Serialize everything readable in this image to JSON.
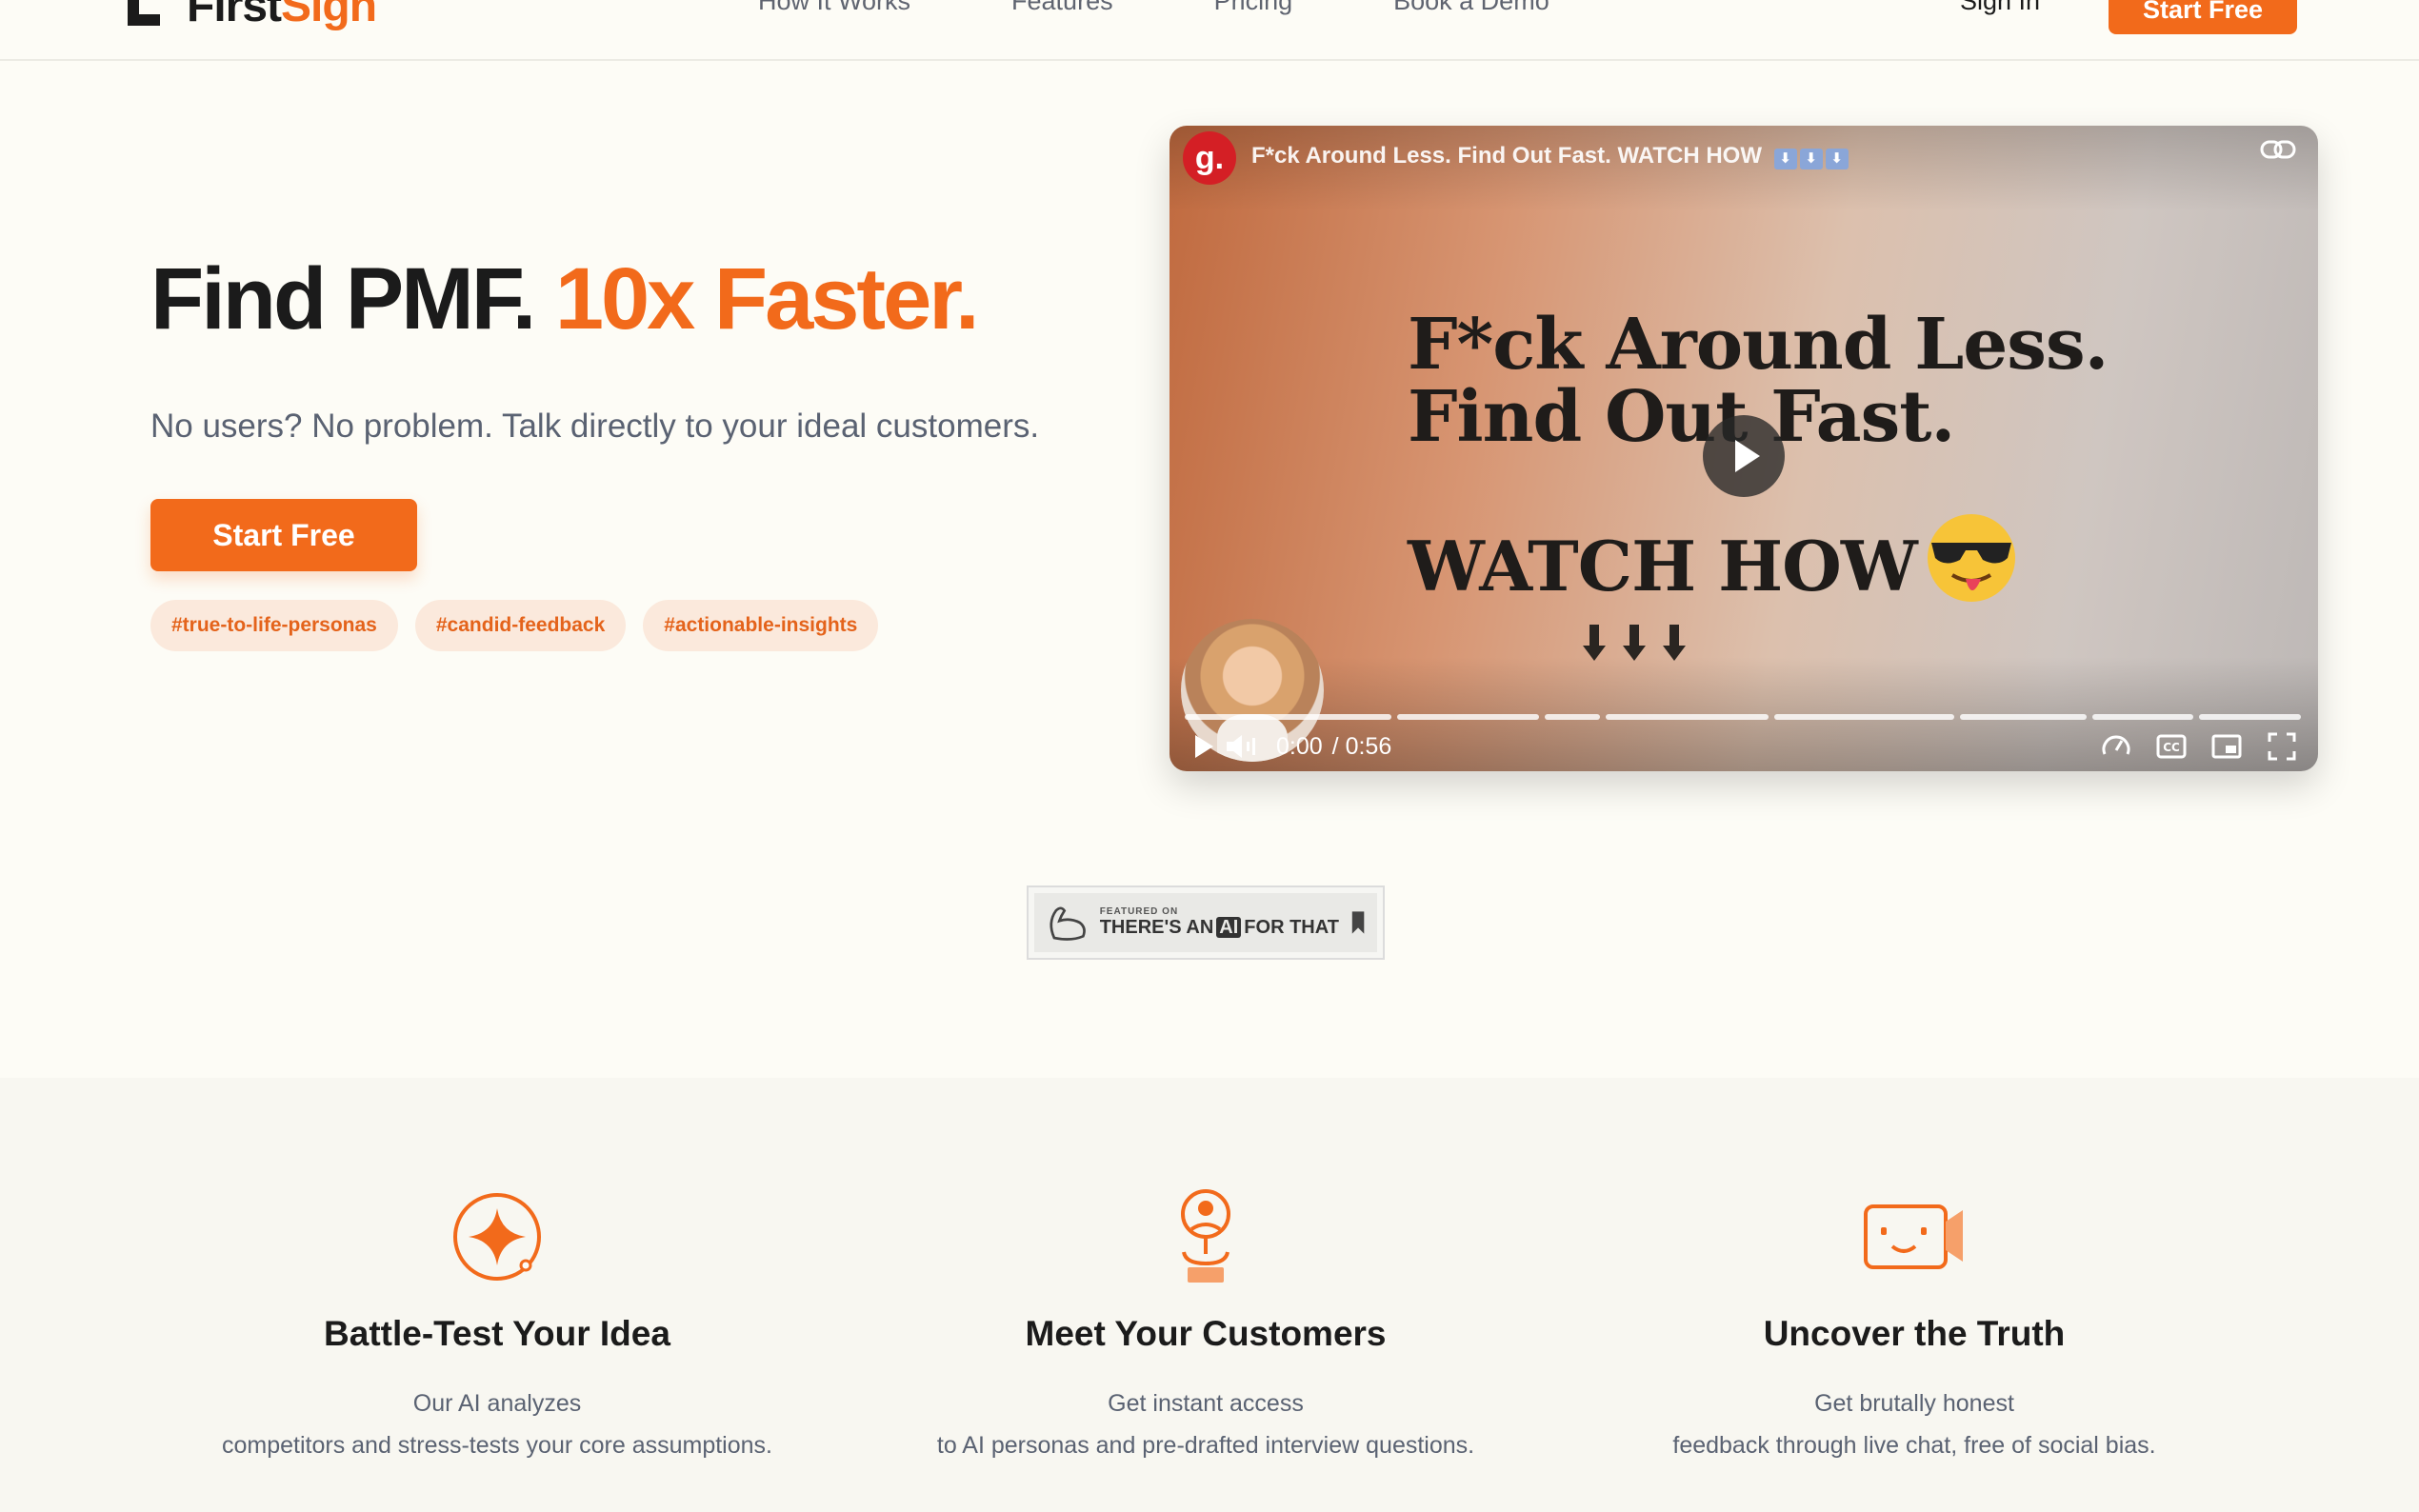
{
  "brand": {
    "name_part1": "First",
    "name_part2": "Sign",
    "accent_color": "#f26a1b"
  },
  "nav": {
    "items": [
      "How It Works",
      "Features",
      "Pricing",
      "Book a Demo"
    ],
    "sign_in": "Sign In",
    "cta": "Start Free"
  },
  "hero": {
    "title_part1": "Find PMF.",
    "title_part2": "10x Faster.",
    "subtitle": "No users? No problem. Talk directly to your ideal customers.",
    "cta": "Start Free",
    "tags": [
      "#true-to-life-personas",
      "#candid-feedback",
      "#actionable-insights"
    ]
  },
  "video": {
    "channel_logo": "g.",
    "title": "F*ck Around Less. Find Out Fast. WATCH HOW",
    "title_emoji": [
      "⬇",
      "⬇",
      "⬇"
    ],
    "headline_line1": "F*ck Around Less.",
    "headline_line2": "Find Out Fast.",
    "watch": "WATCH HOW",
    "emoji": "sunglasses-tongue-emoji",
    "time_current": "0:00",
    "time_total": "/ 0:56",
    "progress": 0.0,
    "icons": [
      "play-icon",
      "volume-icon",
      "speed-icon",
      "captions-icon",
      "pip-icon",
      "fullscreen-icon",
      "link-icon"
    ]
  },
  "featured_badge": {
    "small": "FEATURED ON",
    "big_part1": "THERE'S AN",
    "big_ai": "AI",
    "big_part2": "FOR THAT"
  },
  "features": [
    {
      "icon": "sparkle-icon",
      "title": "Battle-Test Your Idea",
      "line1": "Our AI analyzes",
      "line2": "competitors and stress-tests your core assumptions."
    },
    {
      "icon": "persona-icon",
      "title": "Meet Your Customers",
      "line1": "Get instant access",
      "line2": "to AI personas and pre-drafted interview questions."
    },
    {
      "icon": "video-chat-icon",
      "title": "Uncover the Truth",
      "line1": "Get brutally honest",
      "line2": "feedback through live chat, free of social bias."
    }
  ]
}
